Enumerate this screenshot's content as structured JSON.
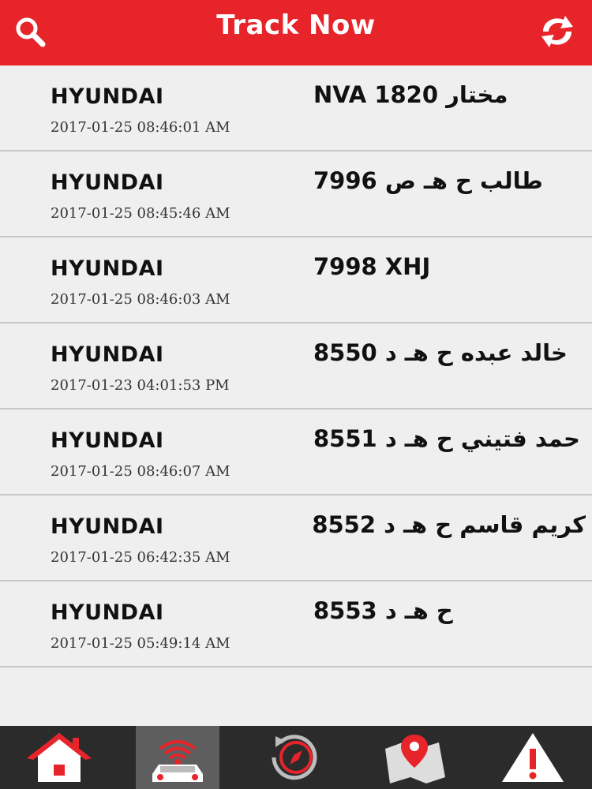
{
  "header": {
    "title": "Track Now",
    "search_icon": "search-icon",
    "refresh_icon": "refresh-icon",
    "background": "#e8242b"
  },
  "vehicles": [
    {
      "make": "HYUNDAI",
      "plate": "مختار 1820 NVA",
      "timestamp": "2017-01-25 08:46:01 AM"
    },
    {
      "make": "HYUNDAI",
      "plate": "طالب ح هـ ص 7996",
      "timestamp": "2017-01-25 08:45:46 AM"
    },
    {
      "make": "HYUNDAI",
      "plate": "7998 XHJ",
      "timestamp": "2017-01-25 08:46:03 AM"
    },
    {
      "make": "HYUNDAI",
      "plate": "خالد عبده ح هـ د 8550",
      "timestamp": "2017-01-23 04:01:53 PM"
    },
    {
      "make": "HYUNDAI",
      "plate": "حمد فتيني ح هـ د 8551",
      "timestamp": "2017-01-25 08:46:07 AM"
    },
    {
      "make": "HYUNDAI",
      "plate": "كريم قاسم ح هـ د 8552",
      "timestamp": "2017-01-25 06:42:35 AM"
    },
    {
      "make": "HYUNDAI",
      "plate": "ح هـ د 8553",
      "timestamp": "2017-01-25 05:49:14 AM"
    }
  ],
  "tabbar": {
    "tabs": [
      {
        "name": "home",
        "icon": "home-icon",
        "active": false
      },
      {
        "name": "track",
        "icon": "car-signal-icon",
        "active": true
      },
      {
        "name": "history",
        "icon": "compass-history-icon",
        "active": false
      },
      {
        "name": "map",
        "icon": "map-pin-icon",
        "active": false
      },
      {
        "name": "alerts",
        "icon": "warning-icon",
        "active": false
      }
    ],
    "background": "#2b2b2b",
    "active_background": "#5e5e5e"
  }
}
